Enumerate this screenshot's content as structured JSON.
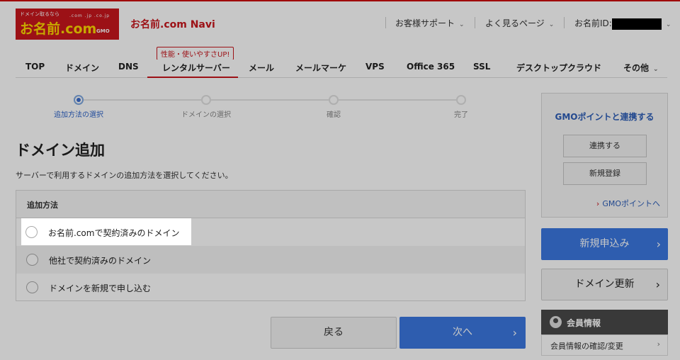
{
  "header": {
    "logo": {
      "tagline": "ドメイン取るなら",
      "main": "お名前.com",
      "tlds": ".com .jp .co.jp",
      "brand": "GMO"
    },
    "title": "お名前.com Navi",
    "support": "お客様サポート",
    "faq": "よく見るページ",
    "id_label": "お名前ID:"
  },
  "nav": {
    "badge": "性能・使いやすさUP!",
    "items": [
      "TOP",
      "ドメイン",
      "DNS",
      "レンタルサーバー",
      "メール",
      "メールマーケ",
      "VPS",
      "Office 365",
      "SSL",
      "デスクトップクラウド",
      "その他"
    ]
  },
  "stepper": {
    "steps": [
      "追加方法の選択",
      "ドメインの選択",
      "確認",
      "完了"
    ],
    "active_index": 0
  },
  "main": {
    "title": "ドメイン追加",
    "description": "サーバーで利用するドメインの追加方法を選択してください。",
    "method_header": "追加方法",
    "options": [
      "お名前.comで契約済みのドメイン",
      "他社で契約済みのドメイン",
      "ドメインを新規で申し込む"
    ],
    "back_label": "戻る",
    "next_label": "次へ"
  },
  "sidebar": {
    "gmo_title": "GMOポイントと連携する",
    "link_button": "連携する",
    "register_button": "新規登録",
    "gmo_link": "GMOポイントへ",
    "new_apply": "新規申込み",
    "renew": "ドメイン更新",
    "member_title": "会員情報",
    "member_item": "会員情報の確認/変更"
  },
  "colors": {
    "brand_red": "#c8161d",
    "accent_blue": "#3b78e0",
    "link_blue": "#2d5eb8"
  }
}
